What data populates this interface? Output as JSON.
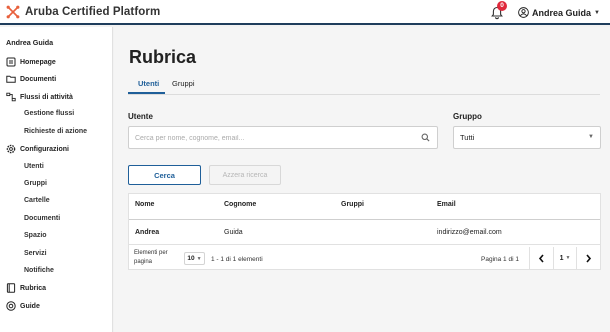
{
  "app": {
    "title": "Aruba Certified Platform"
  },
  "header": {
    "notifications_count": "0",
    "user_name": "Andrea Guida"
  },
  "sidebar": {
    "user": "Andrea Guida",
    "items": [
      {
        "label": "Homepage",
        "icon": "home-icon"
      },
      {
        "label": "Documenti",
        "icon": "folder-icon"
      },
      {
        "label": "Flussi di attività",
        "icon": "workflow-icon"
      },
      {
        "label": "Gestione flussi"
      },
      {
        "label": "Richieste di azione"
      },
      {
        "label": "Configurazioni",
        "icon": "gear-icon"
      },
      {
        "label": "Utenti"
      },
      {
        "label": "Gruppi"
      },
      {
        "label": "Cartelle"
      },
      {
        "label": "Documenti"
      },
      {
        "label": "Spazio"
      },
      {
        "label": "Servizi"
      },
      {
        "label": "Notifiche"
      },
      {
        "label": "Rubrica",
        "icon": "address-book-icon"
      },
      {
        "label": "Guide",
        "icon": "help-icon"
      }
    ]
  },
  "main": {
    "title": "Rubrica",
    "tabs": [
      {
        "label": "Utenti",
        "active": true
      },
      {
        "label": "Gruppi",
        "active": false
      }
    ],
    "filters": {
      "user_label": "Utente",
      "user_placeholder": "Cerca per nome, cognome, email...",
      "group_label": "Gruppo",
      "group_value": "Tutti"
    },
    "buttons": {
      "search": "Cerca",
      "reset": "Azzera ricerca"
    },
    "table": {
      "columns": [
        "Nome",
        "Cognome",
        "Gruppi",
        "Email"
      ],
      "rows": [
        {
          "nome": "Andrea",
          "cognome": "Guida",
          "gruppi": "",
          "email": "indirizzo@email.com"
        }
      ]
    },
    "pagination": {
      "per_page_label": "Elementi per pagina",
      "per_page_value": "10",
      "range": "1 - 1 di 1 elementi",
      "page_info": "Pagina 1 di 1",
      "current_page": "1"
    }
  },
  "colors": {
    "accent": "#1f5f99",
    "header_border": "#1f3d5c",
    "badge": "#e0293b",
    "logo": "#e8603c"
  }
}
